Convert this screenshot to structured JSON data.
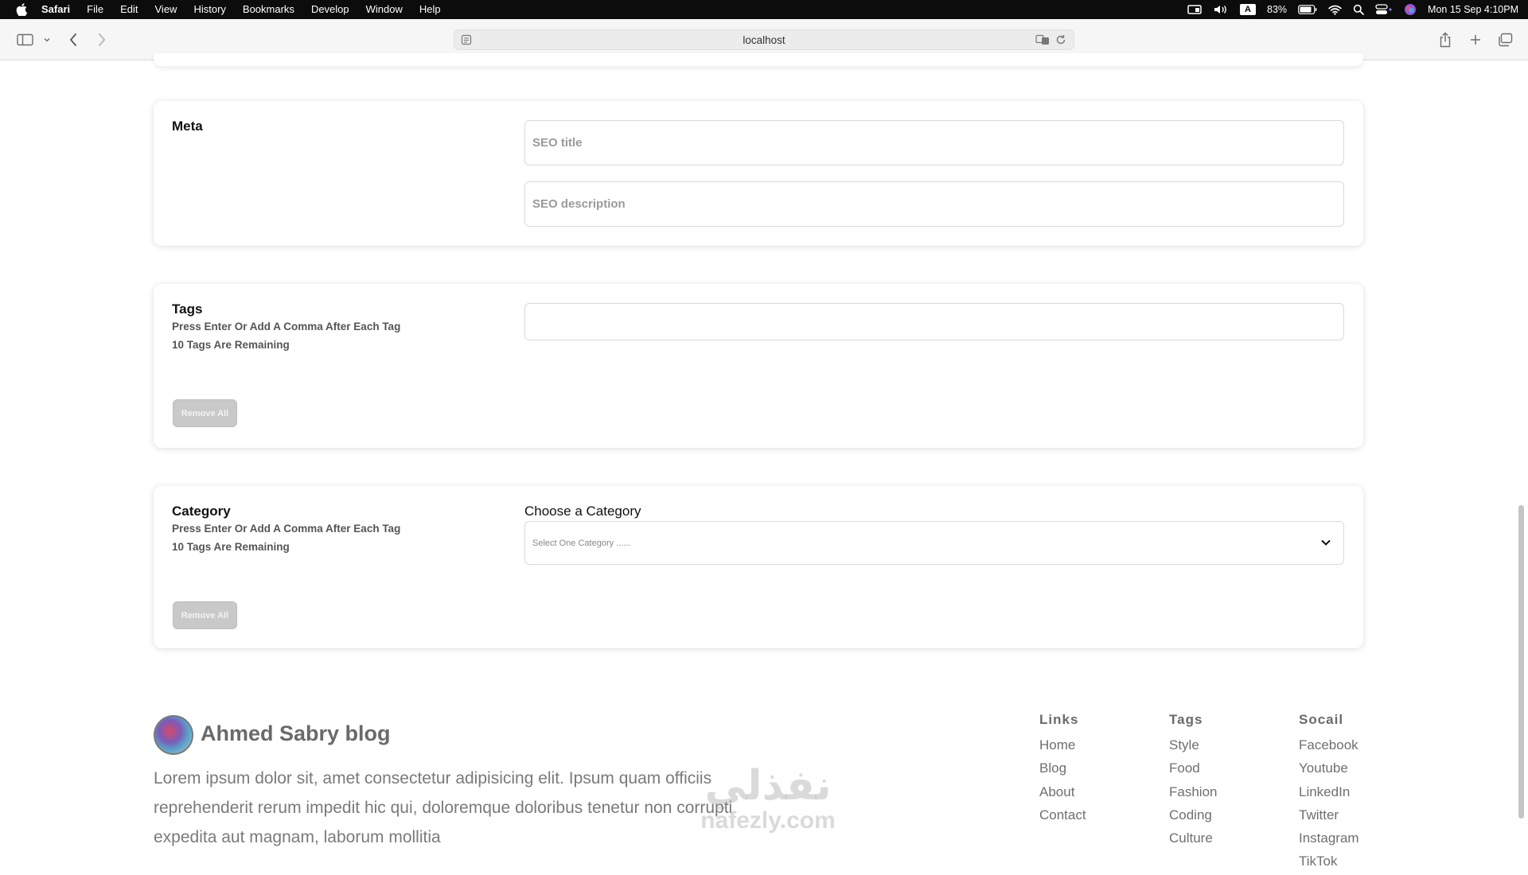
{
  "menubar": {
    "app": "Safari",
    "items": [
      "File",
      "Edit",
      "View",
      "History",
      "Bookmarks",
      "Develop",
      "Window",
      "Help"
    ],
    "input_source": "A",
    "battery": "83%",
    "datetime": "Mon 15 Sep  4:10PM"
  },
  "browser": {
    "url": "localhost"
  },
  "meta_card": {
    "title": "Meta",
    "seo_title_placeholder": "SEO title",
    "seo_description_placeholder": "SEO description"
  },
  "tags_card": {
    "title": "Tags",
    "hint": "Press Enter Or Add A Comma After Each Tag",
    "remaining": "10 Tags Are Remaining",
    "remove_all": "Remove All"
  },
  "category_card": {
    "title": "Category",
    "hint": "Press Enter Or Add A Comma After Each Tag",
    "remaining": "10 Tags Are Remaining",
    "remove_all": "Remove All",
    "choose_label": "Choose a Category",
    "select_value": "Select One Category ......"
  },
  "footer": {
    "blog_name": "Ahmed Sabry blog",
    "description": "Lorem ipsum dolor sit, amet consectetur adipisicing elit. Ipsum quam officiis reprehenderit rerum impedit hic qui, doloremque doloribus tenetur non corrupti expedita aut magnam, laborum mollitia",
    "columns": [
      {
        "heading": "Links",
        "items": [
          "Home",
          "Blog",
          "About",
          "Contact"
        ]
      },
      {
        "heading": "Tags",
        "items": [
          "Style",
          "Food",
          "Fashion",
          "Coding",
          "Culture"
        ]
      },
      {
        "heading": "Socail",
        "items": [
          "Facebook",
          "Youtube",
          "LinkedIn",
          "Twitter",
          "Instagram",
          "TikTok"
        ]
      }
    ]
  },
  "watermark": {
    "arabic": "نفذلي",
    "latin": "nafezly.com"
  }
}
